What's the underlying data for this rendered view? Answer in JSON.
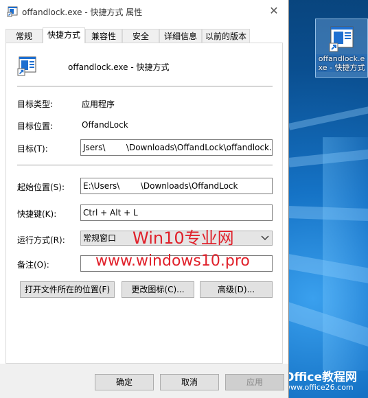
{
  "window": {
    "title": "offandlock.exe - 快捷方式 属性",
    "close_glyph": "✕"
  },
  "tabs": [
    {
      "label": "常规",
      "active": false
    },
    {
      "label": "快捷方式",
      "active": true
    },
    {
      "label": "兼容性",
      "active": false
    },
    {
      "label": "安全",
      "active": false
    },
    {
      "label": "详细信息",
      "active": false
    },
    {
      "label": "以前的版本",
      "active": false
    }
  ],
  "shortcut": {
    "name": "offandlock.exe - 快捷方式",
    "target_type_label": "目标类型:",
    "target_type_value": "应用程序",
    "target_location_label": "目标位置:",
    "target_location_value": "OffandLock",
    "target_label": "目标(T):",
    "target_value": "Jsers\\        \\Downloads\\OffandLock\\offandlock.exe",
    "start_in_label": "起始位置(S):",
    "start_in_value": "E:\\Users\\        \\Downloads\\OffandLock",
    "hotkey_label": "快捷键(K):",
    "hotkey_value": "Ctrl + Alt + L",
    "run_label": "运行方式(R):",
    "run_value": "常规窗口",
    "comment_label": "备注(O):",
    "comment_value": ""
  },
  "buttons": {
    "open_location": "打开文件所在的位置(F)",
    "change_icon": "更改图标(C)...",
    "advanced": "高级(D)...",
    "ok": "确定",
    "cancel": "取消",
    "apply": "应用"
  },
  "watermarks": {
    "win10": "Win10专业网",
    "url": "www.windows10.pro",
    "office_brand": "Office教程网",
    "office_url": "www.office26.com"
  },
  "desktop": {
    "icon_label": "offandlock.exe - 快捷方式"
  },
  "colors": {
    "watermark_red": "#e0202a",
    "office_orange": "#e8541e",
    "desktop_blue": "#0a4e8f",
    "shortcut_icon_blue": "#1e6fd0"
  }
}
